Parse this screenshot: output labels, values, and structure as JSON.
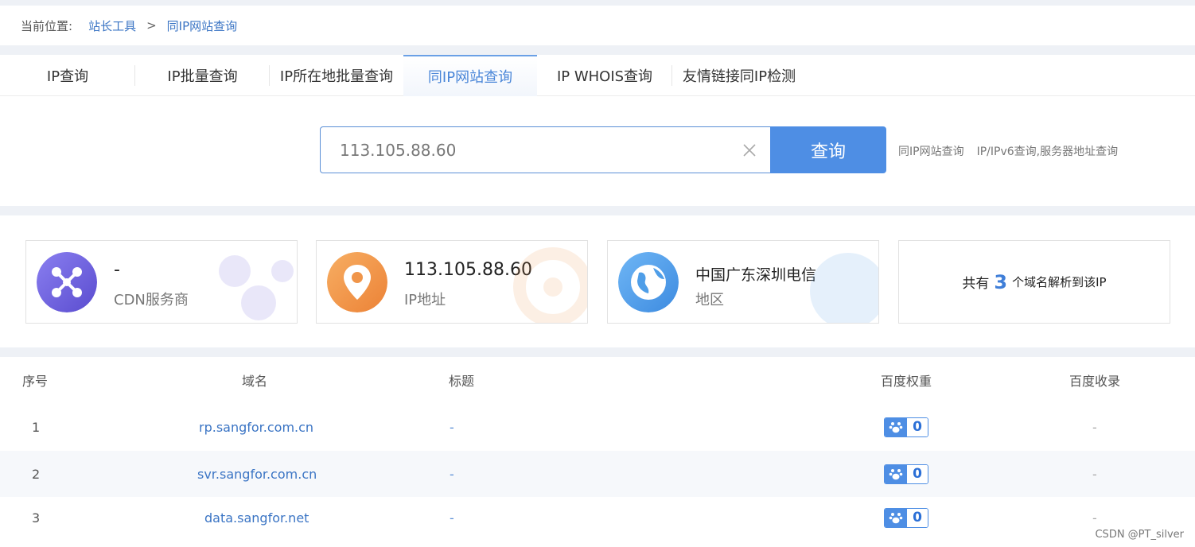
{
  "breadcrumb": {
    "label": "当前位置:",
    "items": [
      "站长工具",
      ">",
      "同IP网站查询"
    ]
  },
  "tabs": [
    {
      "label": "IP查询",
      "active": false
    },
    {
      "label": "IP批量查询",
      "active": false
    },
    {
      "label": "IP所在地批量查询",
      "active": false
    },
    {
      "label": "同IP网站查询",
      "active": true
    },
    {
      "label": "IP WHOIS查询",
      "active": false
    },
    {
      "label": "友情链接同IP检测",
      "active": false
    }
  ],
  "search": {
    "value": "113.105.88.60",
    "button_label": "查询",
    "related_links": [
      "同IP网站查询",
      "IP/IPv6查询,服务器地址查询"
    ]
  },
  "cards": [
    {
      "value": "-",
      "label": "CDN服务商",
      "icon": "cdn-hub-icon",
      "color": "#6b5fd8"
    },
    {
      "value": "113.105.88.60",
      "label": "IP地址",
      "icon": "location-pin-icon",
      "color": "#f0954a"
    },
    {
      "value": "中国广东深圳电信",
      "label": "地区",
      "icon": "globe-icon",
      "color": "#4f9ee8"
    }
  ],
  "summary": {
    "prefix": "共有",
    "count": "3",
    "suffix": "个域名解析到该IP"
  },
  "table": {
    "headers": [
      "序号",
      "域名",
      "标题",
      "百度权重",
      "百度收录"
    ],
    "rows": [
      {
        "index": "1",
        "domain": "rp.sangfor.com.cn",
        "title": "-",
        "weight": "0",
        "indexed": "-"
      },
      {
        "index": "2",
        "domain": "svr.sangfor.com.cn",
        "title": "-",
        "weight": "0",
        "indexed": "-"
      },
      {
        "index": "3",
        "domain": "data.sangfor.net",
        "title": "-",
        "weight": "0",
        "indexed": "-"
      }
    ]
  },
  "watermark": "CSDN @PT_silver",
  "colors": {
    "accent": "#4e8ee4",
    "link": "#3a74c4"
  }
}
